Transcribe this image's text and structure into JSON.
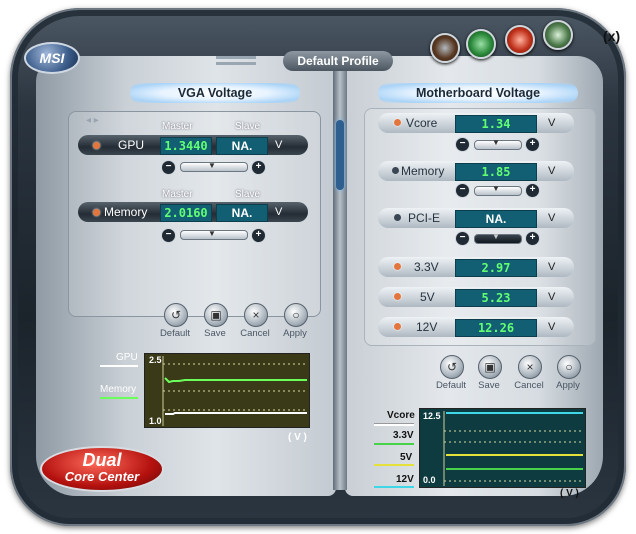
{
  "window": {
    "brand": "MSI",
    "profile": "Default Profile",
    "close_label": "(x)"
  },
  "vga": {
    "title": "VGA Voltage",
    "header_master": "Master",
    "header_slave": "Slave",
    "gpu": {
      "label": "GPU",
      "master": "1.3440",
      "slave": "NA.",
      "unit": "V"
    },
    "memory": {
      "label": "Memory",
      "master": "2.0160",
      "slave": "NA.",
      "unit": "V"
    },
    "buttons": [
      "Default",
      "Save",
      "Cancel",
      "Apply"
    ],
    "graph": {
      "legend_gpu": "GPU",
      "legend_memory": "Memory",
      "ymax": "2.5",
      "ymin": "1.0",
      "unit": "( V )"
    }
  },
  "mb": {
    "title": "Motherboard Voltage",
    "rows": [
      {
        "label": "Vcore",
        "value": "1.34",
        "unit": "V"
      },
      {
        "label": "Memory",
        "value": "1.85",
        "unit": "V"
      },
      {
        "label": "PCI-E",
        "value": "NA.",
        "unit": "V"
      },
      {
        "label": "3.3V",
        "value": "2.97",
        "unit": "V"
      },
      {
        "label": "5V",
        "value": "5.23",
        "unit": "V"
      },
      {
        "label": "12V",
        "value": "12.26",
        "unit": "V"
      }
    ],
    "buttons": [
      "Default",
      "Save",
      "Cancel",
      "Apply"
    ],
    "graph": {
      "legend_vcore": "Vcore",
      "legend_33": "3.3V",
      "legend_5": "5V",
      "legend_12": "12V",
      "ymax": "12.5",
      "ymin": "0.0",
      "unit": "( V )"
    }
  },
  "logo": {
    "line1": "Dual",
    "line2": "Core Center"
  },
  "colors": {
    "value_green": "#63ff72",
    "value_bg": "#125e72",
    "accent_blue": "#a9d3f7"
  }
}
